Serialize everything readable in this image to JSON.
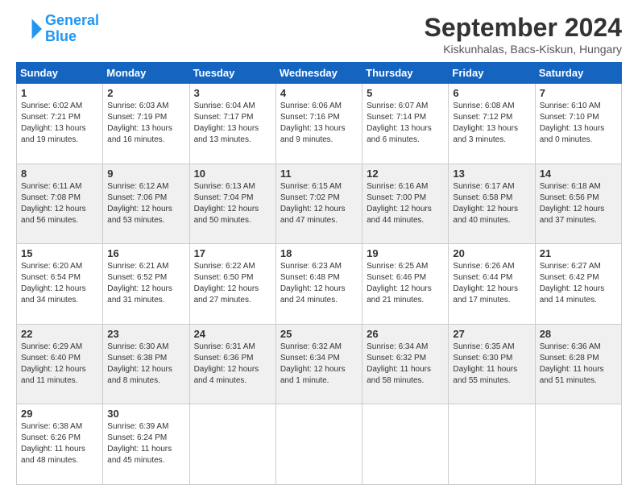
{
  "header": {
    "logo_general": "General",
    "logo_blue": "Blue",
    "month_title": "September 2024",
    "location": "Kiskunhalas, Bacs-Kiskun, Hungary"
  },
  "weekdays": [
    "Sunday",
    "Monday",
    "Tuesday",
    "Wednesday",
    "Thursday",
    "Friday",
    "Saturday"
  ],
  "weeks": [
    [
      {
        "day": "1",
        "sunrise": "6:02 AM",
        "sunset": "7:21 PM",
        "daylight": "13 hours and 19 minutes."
      },
      {
        "day": "2",
        "sunrise": "6:03 AM",
        "sunset": "7:19 PM",
        "daylight": "13 hours and 16 minutes."
      },
      {
        "day": "3",
        "sunrise": "6:04 AM",
        "sunset": "7:17 PM",
        "daylight": "13 hours and 13 minutes."
      },
      {
        "day": "4",
        "sunrise": "6:06 AM",
        "sunset": "7:16 PM",
        "daylight": "13 hours and 9 minutes."
      },
      {
        "day": "5",
        "sunrise": "6:07 AM",
        "sunset": "7:14 PM",
        "daylight": "13 hours and 6 minutes."
      },
      {
        "day": "6",
        "sunrise": "6:08 AM",
        "sunset": "7:12 PM",
        "daylight": "13 hours and 3 minutes."
      },
      {
        "day": "7",
        "sunrise": "6:10 AM",
        "sunset": "7:10 PM",
        "daylight": "13 hours and 0 minutes."
      }
    ],
    [
      {
        "day": "8",
        "sunrise": "6:11 AM",
        "sunset": "7:08 PM",
        "daylight": "12 hours and 56 minutes."
      },
      {
        "day": "9",
        "sunrise": "6:12 AM",
        "sunset": "7:06 PM",
        "daylight": "12 hours and 53 minutes."
      },
      {
        "day": "10",
        "sunrise": "6:13 AM",
        "sunset": "7:04 PM",
        "daylight": "12 hours and 50 minutes."
      },
      {
        "day": "11",
        "sunrise": "6:15 AM",
        "sunset": "7:02 PM",
        "daylight": "12 hours and 47 minutes."
      },
      {
        "day": "12",
        "sunrise": "6:16 AM",
        "sunset": "7:00 PM",
        "daylight": "12 hours and 44 minutes."
      },
      {
        "day": "13",
        "sunrise": "6:17 AM",
        "sunset": "6:58 PM",
        "daylight": "12 hours and 40 minutes."
      },
      {
        "day": "14",
        "sunrise": "6:18 AM",
        "sunset": "6:56 PM",
        "daylight": "12 hours and 37 minutes."
      }
    ],
    [
      {
        "day": "15",
        "sunrise": "6:20 AM",
        "sunset": "6:54 PM",
        "daylight": "12 hours and 34 minutes."
      },
      {
        "day": "16",
        "sunrise": "6:21 AM",
        "sunset": "6:52 PM",
        "daylight": "12 hours and 31 minutes."
      },
      {
        "day": "17",
        "sunrise": "6:22 AM",
        "sunset": "6:50 PM",
        "daylight": "12 hours and 27 minutes."
      },
      {
        "day": "18",
        "sunrise": "6:23 AM",
        "sunset": "6:48 PM",
        "daylight": "12 hours and 24 minutes."
      },
      {
        "day": "19",
        "sunrise": "6:25 AM",
        "sunset": "6:46 PM",
        "daylight": "12 hours and 21 minutes."
      },
      {
        "day": "20",
        "sunrise": "6:26 AM",
        "sunset": "6:44 PM",
        "daylight": "12 hours and 17 minutes."
      },
      {
        "day": "21",
        "sunrise": "6:27 AM",
        "sunset": "6:42 PM",
        "daylight": "12 hours and 14 minutes."
      }
    ],
    [
      {
        "day": "22",
        "sunrise": "6:29 AM",
        "sunset": "6:40 PM",
        "daylight": "12 hours and 11 minutes."
      },
      {
        "day": "23",
        "sunrise": "6:30 AM",
        "sunset": "6:38 PM",
        "daylight": "12 hours and 8 minutes."
      },
      {
        "day": "24",
        "sunrise": "6:31 AM",
        "sunset": "6:36 PM",
        "daylight": "12 hours and 4 minutes."
      },
      {
        "day": "25",
        "sunrise": "6:32 AM",
        "sunset": "6:34 PM",
        "daylight": "12 hours and 1 minute."
      },
      {
        "day": "26",
        "sunrise": "6:34 AM",
        "sunset": "6:32 PM",
        "daylight": "11 hours and 58 minutes."
      },
      {
        "day": "27",
        "sunrise": "6:35 AM",
        "sunset": "6:30 PM",
        "daylight": "11 hours and 55 minutes."
      },
      {
        "day": "28",
        "sunrise": "6:36 AM",
        "sunset": "6:28 PM",
        "daylight": "11 hours and 51 minutes."
      }
    ],
    [
      {
        "day": "29",
        "sunrise": "6:38 AM",
        "sunset": "6:26 PM",
        "daylight": "11 hours and 48 minutes."
      },
      {
        "day": "30",
        "sunrise": "6:39 AM",
        "sunset": "6:24 PM",
        "daylight": "11 hours and 45 minutes."
      },
      null,
      null,
      null,
      null,
      null
    ]
  ]
}
